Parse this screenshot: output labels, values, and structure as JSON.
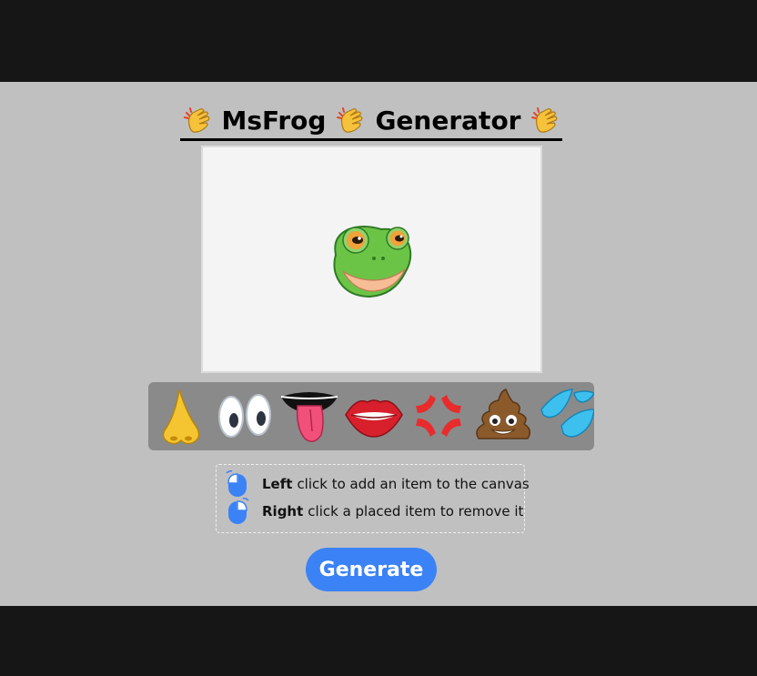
{
  "header": {
    "title_part1": "MsFrog",
    "title_part2": "Generator",
    "decoration_icon": "clapping-hands-icon"
  },
  "canvas": {
    "base_item": "frog-face"
  },
  "palette": {
    "items": [
      {
        "name": "nose-icon"
      },
      {
        "name": "eyes-icon"
      },
      {
        "name": "tongue-mouth-icon"
      },
      {
        "name": "lips-icon"
      },
      {
        "name": "anger-symbol-icon"
      },
      {
        "name": "poop-icon"
      },
      {
        "name": "sweat-droplets-icon"
      }
    ]
  },
  "help": {
    "left_bold": "Left",
    "left_text": "click to add an item to the canvas",
    "right_bold": "Right",
    "right_text": "click a placed item to remove it"
  },
  "actions": {
    "generate_label": "Generate"
  },
  "colors": {
    "page_bg": "#161616",
    "main_bg": "#c0c0c0",
    "canvas_bg": "#f4f4f4",
    "palette_bg": "#8a8a8a",
    "accent": "#3b82f6"
  }
}
